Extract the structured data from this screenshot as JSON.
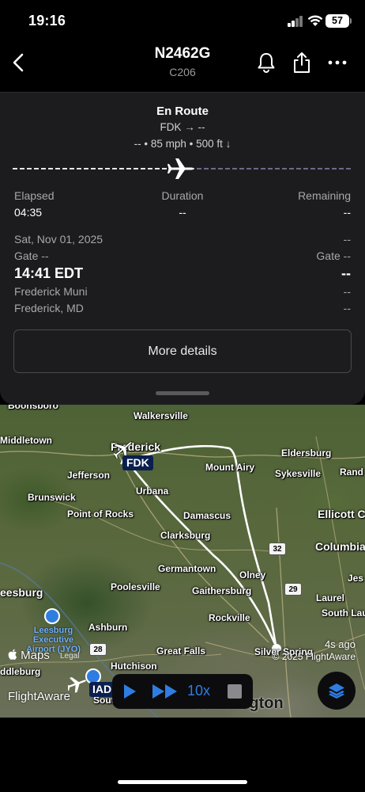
{
  "status_bar": {
    "time": "19:16",
    "battery": "57"
  },
  "header": {
    "title": "N2462G",
    "subtitle": "C206"
  },
  "flight": {
    "status": "En Route",
    "route": "FDK → --",
    "speed_line": "-- • 85 mph • 500 ft ↓",
    "progress_fraction": 0.5
  },
  "times": {
    "elapsed_label": "Elapsed",
    "elapsed_value": "04:35",
    "duration_label": "Duration",
    "duration_value": "--",
    "remaining_label": "Remaining",
    "remaining_value": "--"
  },
  "departure": {
    "date": "Sat, Nov 01, 2025",
    "gate": "Gate --",
    "time": "14:41 EDT",
    "airport": "Frederick Muni",
    "city": "Frederick, MD"
  },
  "arrival": {
    "date": "--",
    "gate": "Gate --",
    "time": "--",
    "airport": "--",
    "city": "--"
  },
  "more_details_label": "More details",
  "map": {
    "places": {
      "boonsboro": "Boonsboro",
      "walkersville": "Walkersville",
      "middletown": "Middletown",
      "frederick": "Frederick",
      "eldersburg": "Eldersburg",
      "jefferson": "Jefferson",
      "mount_airy": "Mount Airy",
      "sykesville": "Sykesville",
      "randallstown": "Rand",
      "brunswick": "Brunswick",
      "urbana": "Urbana",
      "point_of_rocks": "Point of Rocks",
      "damascus": "Damascus",
      "ellicott_city": "Ellicott C",
      "clarksburg": "Clarksburg",
      "columbia": "Columbia",
      "germantown": "Germantown",
      "olney": "Olney",
      "poolesville": "Poolesville",
      "gaithersburg": "Gaithersburg",
      "laurel": "Laurel",
      "leesburg": "eesburg",
      "rockville": "Rockville",
      "south_laurel": "South Lau",
      "ashburn": "Ashburn",
      "great_falls": "Great Falls",
      "silver_spring": "Silver Spring",
      "hutchison": "Hutchison",
      "middleburg": "ddleburg",
      "south_riding": "South Ri",
      "washington": "Washington",
      "jessup": "Jes"
    },
    "route_badges": {
      "r32": "32",
      "r29": "29",
      "r28": "28"
    },
    "fdk_label": "FDK",
    "iad_label": "IAD",
    "jyo_label": "Leesburg\nExecutive\nAirport (JYO)",
    "timestamp": "4s ago",
    "copyright": "© 2025 FlightAware",
    "maps_label": "Maps",
    "legal_label": "Legal",
    "flightaware_label": "FlightAware"
  },
  "playback": {
    "speed": "10x"
  },
  "colors": {
    "accent": "#2f7de1",
    "panel": "#1c1c1e",
    "badge": "#0b1f4f"
  }
}
